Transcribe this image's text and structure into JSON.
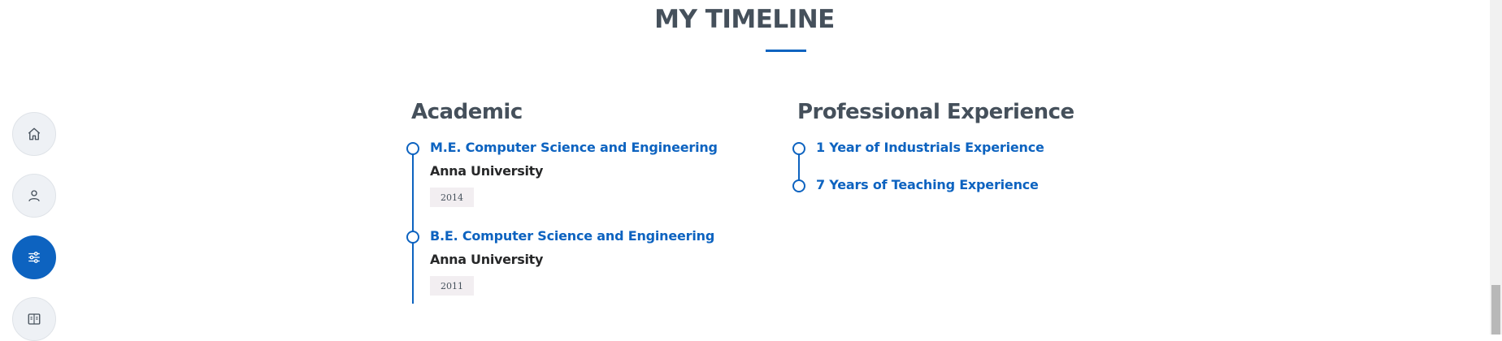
{
  "section": {
    "title": "MY TIMELINE"
  },
  "nav": {
    "items": [
      {
        "icon": "home-icon",
        "active": false
      },
      {
        "icon": "person-icon",
        "active": false
      },
      {
        "icon": "sliders-icon",
        "active": true
      },
      {
        "icon": "book-icon",
        "active": false
      }
    ]
  },
  "academic": {
    "heading": "Academic",
    "items": [
      {
        "title": "M.E. Computer Science and Engineering",
        "institution": "Anna University",
        "year": "2014"
      },
      {
        "title": "B.E. Computer Science and Engineering",
        "institution": "Anna University",
        "year": "2011"
      }
    ]
  },
  "professional": {
    "heading": "Professional Experience",
    "items": [
      {
        "title": "1 Year of Industrials Experience"
      },
      {
        "title": "7 Years of Teaching Experience"
      }
    ]
  },
  "colors": {
    "accent": "#0d63c0",
    "heading": "#45505b",
    "text": "#272829",
    "year_bg": "#f2eef1"
  }
}
